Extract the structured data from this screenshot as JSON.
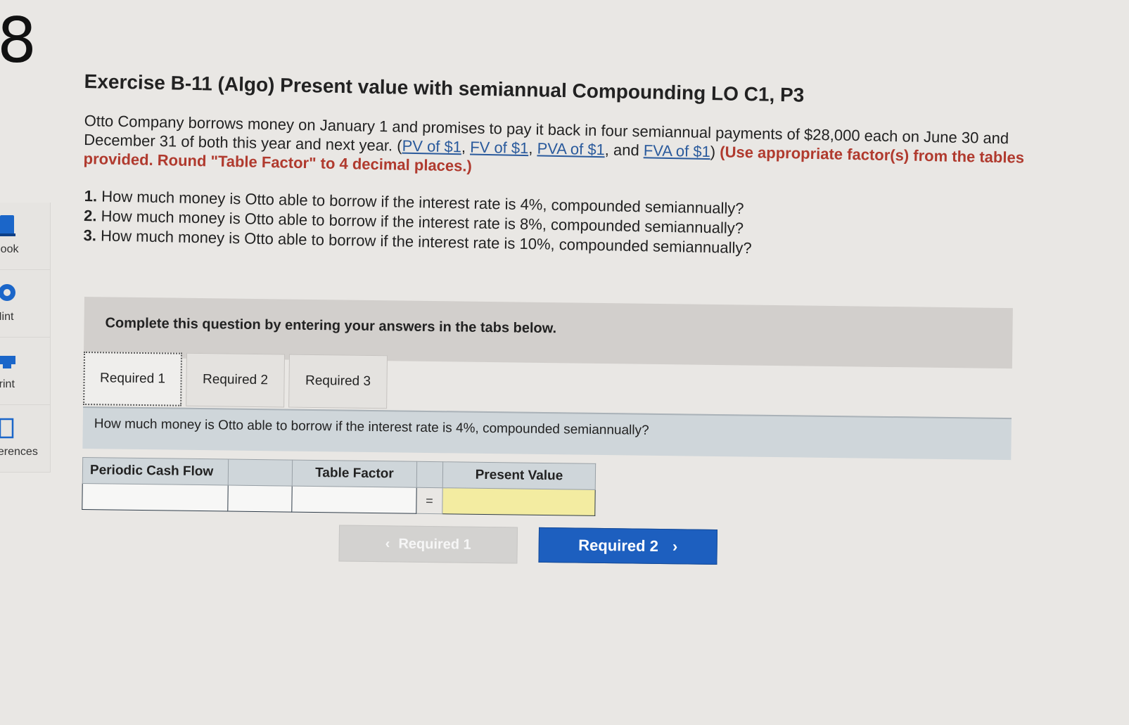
{
  "question_number": "8",
  "sidebar": {
    "items": [
      {
        "label": "Book",
        "icon": "book-icon"
      },
      {
        "label": "Hint",
        "icon": "hint-icon"
      },
      {
        "label": "Print",
        "icon": "print-icon"
      },
      {
        "label": "References",
        "icon": "references-icon"
      }
    ]
  },
  "exercise": {
    "title": "Exercise B-11 (Algo) Present value with semiannual Compounding LO C1, P3",
    "problem_text": "Otto Company borrows money on January 1 and promises to pay it back in four semiannual payments of $28,000 each on June 30 and December 31 of both this year and next year.",
    "links_open": "(",
    "links": [
      "PV of $1",
      "FV of $1",
      "PVA of $1",
      "FVA of $1"
    ],
    "links_sep": ", ",
    "links_and": ", and ",
    "links_close": ")",
    "instructions": "(Use appropriate factor(s) from the tables provided. Round \"Table Factor\" to 4 decimal places.)",
    "questions": [
      {
        "num": "1.",
        "text": "How much money is Otto able to borrow if the interest rate is 4%, compounded semiannually?"
      },
      {
        "num": "2.",
        "text": "How much money is Otto able to borrow if the interest rate is 8%, compounded semiannually?"
      },
      {
        "num": "3.",
        "text": "How much money is Otto able to borrow if the interest rate is 10%, compounded semiannually?"
      }
    ]
  },
  "panel": {
    "instruction": "Complete this question by entering your answers in the tabs below.",
    "tabs": [
      "Required 1",
      "Required 2",
      "Required 3"
    ],
    "active_tab": "Required 1",
    "tab_question": "How much money is Otto able to borrow if the interest rate is 4%, compounded semiannually?",
    "table": {
      "headers": [
        "Periodic Cash Flow",
        "Table Factor",
        "Present Value"
      ],
      "equals": "=",
      "values": {
        "periodic_cash_flow": "",
        "blank": "",
        "table_factor": "",
        "present_value": ""
      }
    },
    "nav": {
      "prev_label": "Required 1",
      "prev_icon": "chevron-left-icon",
      "next_label": "Required 2",
      "next_icon": "chevron-right-icon"
    }
  },
  "colors": {
    "link": "#2a5a9c",
    "instructions": "#b03a2e",
    "next_button": "#1d5fbf",
    "result_cell": "#f3eca1"
  }
}
